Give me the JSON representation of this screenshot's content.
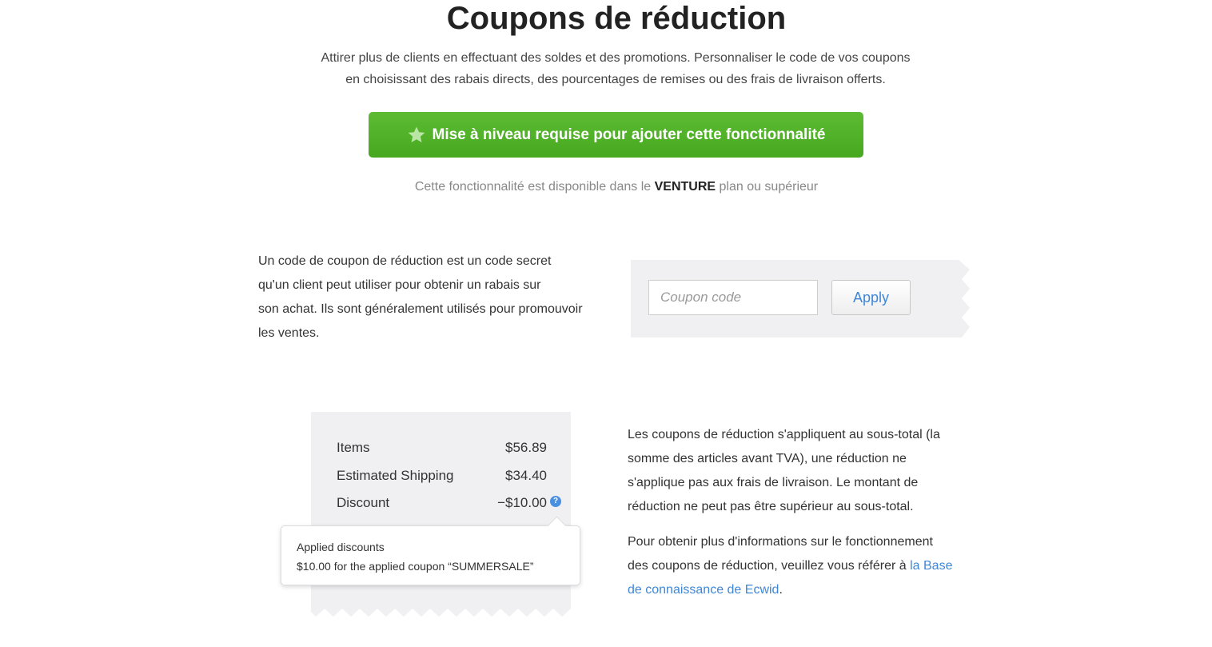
{
  "header": {
    "title": "Coupons de réduction",
    "subtitle_line1": "Attirer plus de clients en effectuant des soldes et des promotions. Personnaliser le code de vos coupons",
    "subtitle_line2": "en choisissant des rabais directs, des pourcentages de remises ou des frais de livraison offerts."
  },
  "upgrade": {
    "label": "Mise à niveau requise pour ajouter cette fonctionnalité",
    "icon": "star-icon",
    "color": "#52b228"
  },
  "availability": {
    "prefix": "Cette fonctionnalité est disponible dans le ",
    "plan": "VENTURE",
    "suffix": " plan ou supérieur"
  },
  "section1": {
    "text_line1": "Un code de coupon de réduction est un code secret",
    "text_line2": "qu'un client peut utiliser pour obtenir un rabais sur",
    "text_line3": "son achat. Ils sont généralement utilisés pour promouvoir",
    "text_line4": "les ventes.",
    "coupon_placeholder": "Coupon code",
    "apply_label": "Apply"
  },
  "receipt": {
    "rows": [
      {
        "label": "Items",
        "value": "$56.89"
      },
      {
        "label": "Estimated Shipping",
        "value": "$34.40"
      },
      {
        "label": "Discount",
        "value": "−$10.00"
      }
    ],
    "help_icon": "question-icon",
    "tooltip_title": "Applied discounts",
    "tooltip_text": "$10.00 for the applied coupon “SUMMERSALE”"
  },
  "section2": {
    "paragraph1_line1": "Les coupons de réduction s'appliquent au sous-total (la",
    "paragraph1_line2": "somme des articles avant TVA), une réduction ne",
    "paragraph1_line3": "s'applique pas aux frais de livraison. Le montant de",
    "paragraph1_line4": "réduction ne peut pas être supérieur au sous-total.",
    "paragraph2_line1": "Pour obtenir plus d'informations sur le fonctionnement",
    "paragraph2_line2_prefix": "des coupons de réduction, veuillez vous référer à ",
    "link_part1": "la Base",
    "link_part2": "de connaissance de Ecwid",
    "paragraph2_end": ".",
    "link_color": "#3f87d6"
  }
}
